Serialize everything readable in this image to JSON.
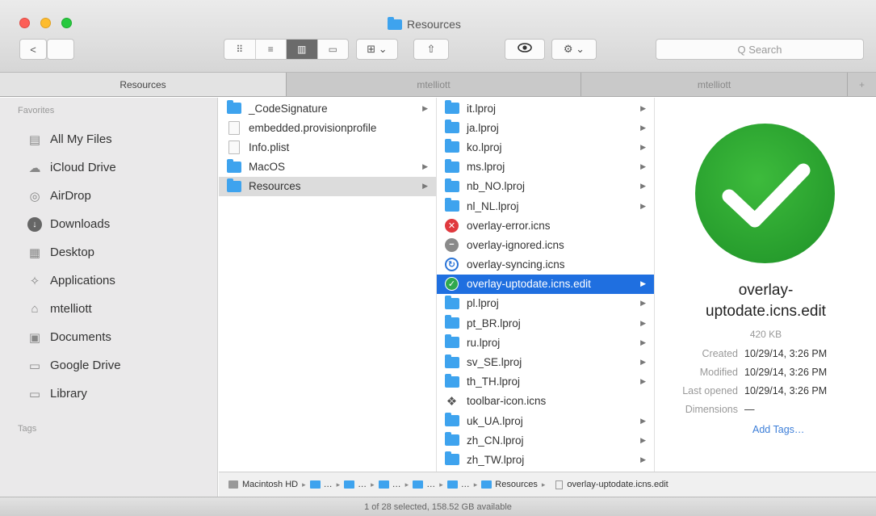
{
  "window": {
    "title": "Resources"
  },
  "toolbar": {
    "back_label": "<",
    "forward_label": "",
    "view_icons": [
      "⠿",
      "≡",
      "▥",
      "▭"
    ],
    "arrange_label": "⊞ ⌄",
    "share_label": "⇧",
    "quicklook_label": "👁",
    "action_label": "⚙ ⌄",
    "search_placeholder": "Q Search"
  },
  "tabs": [
    {
      "label": "Resources",
      "active": true
    },
    {
      "label": "mtelliott",
      "active": false
    },
    {
      "label": "mtelliott",
      "active": false
    },
    {
      "label": "+",
      "active": false
    }
  ],
  "sidebar": {
    "section_favorites": "Favorites",
    "items": [
      {
        "label": "All My Files",
        "icon": "all-files-icon"
      },
      {
        "label": "iCloud Drive",
        "icon": "cloud-icon"
      },
      {
        "label": "AirDrop",
        "icon": "airdrop-icon"
      },
      {
        "label": "Downloads",
        "icon": "downloads-icon"
      },
      {
        "label": "Desktop",
        "icon": "desktop-icon"
      },
      {
        "label": "Applications",
        "icon": "applications-icon"
      },
      {
        "label": "mtelliott",
        "icon": "home-icon"
      },
      {
        "label": "Documents",
        "icon": "documents-icon"
      },
      {
        "label": "Google Drive",
        "icon": "folder-icon"
      },
      {
        "label": "Library",
        "icon": "folder-icon"
      }
    ],
    "section_tags": "Tags"
  },
  "column1": [
    {
      "name": "_CodeSignature",
      "type": "folder",
      "chevron": true
    },
    {
      "name": "embedded.provisionprofile",
      "type": "file",
      "chevron": false
    },
    {
      "name": "Info.plist",
      "type": "file",
      "chevron": false
    },
    {
      "name": "MacOS",
      "type": "folder",
      "chevron": true
    },
    {
      "name": "Resources",
      "type": "folder",
      "chevron": true,
      "selected": true
    }
  ],
  "column2": [
    {
      "name": "it.lproj",
      "type": "folder",
      "chevron": true
    },
    {
      "name": "ja.lproj",
      "type": "folder",
      "chevron": true
    },
    {
      "name": "ko.lproj",
      "type": "folder",
      "chevron": true
    },
    {
      "name": "ms.lproj",
      "type": "folder",
      "chevron": true
    },
    {
      "name": "nb_NO.lproj",
      "type": "folder",
      "chevron": true
    },
    {
      "name": "nl_NL.lproj",
      "type": "folder",
      "chevron": true
    },
    {
      "name": "overlay-error.icns",
      "type": "error",
      "chevron": false
    },
    {
      "name": "overlay-ignored.icns",
      "type": "ignored",
      "chevron": false
    },
    {
      "name": "overlay-syncing.icns",
      "type": "syncing",
      "chevron": false
    },
    {
      "name": "overlay-uptodate.icns.edit",
      "type": "ok",
      "chevron": true,
      "selected": true
    },
    {
      "name": "pl.lproj",
      "type": "folder",
      "chevron": true
    },
    {
      "name": "pt_BR.lproj",
      "type": "folder",
      "chevron": true
    },
    {
      "name": "ru.lproj",
      "type": "folder",
      "chevron": true
    },
    {
      "name": "sv_SE.lproj",
      "type": "folder",
      "chevron": true
    },
    {
      "name": "th_TH.lproj",
      "type": "folder",
      "chevron": true
    },
    {
      "name": "toolbar-icon.icns",
      "type": "toolbar",
      "chevron": false
    },
    {
      "name": "uk_UA.lproj",
      "type": "folder",
      "chevron": true
    },
    {
      "name": "zh_CN.lproj",
      "type": "folder",
      "chevron": true
    },
    {
      "name": "zh_TW.lproj",
      "type": "folder",
      "chevron": true
    }
  ],
  "preview": {
    "name_line1": "overlay-",
    "name_line2": "uptodate.icns.edit",
    "size": "420 KB",
    "meta": [
      {
        "key": "Created",
        "value": "10/29/14, 3:26 PM"
      },
      {
        "key": "Modified",
        "value": "10/29/14, 3:26 PM"
      },
      {
        "key": "Last opened",
        "value": "10/29/14, 3:26 PM"
      },
      {
        "key": "Dimensions",
        "value": "—"
      }
    ],
    "add_tags": "Add Tags…"
  },
  "pathbar": {
    "volume": "Macintosh HD",
    "resources": "Resources",
    "file": "overlay-uptodate.icns.edit"
  },
  "status": "1 of 28 selected, 158.52 GB available",
  "colors": {
    "selection": "#1f6fe0",
    "folder": "#3ea3ee",
    "check": "#2fa84f"
  }
}
